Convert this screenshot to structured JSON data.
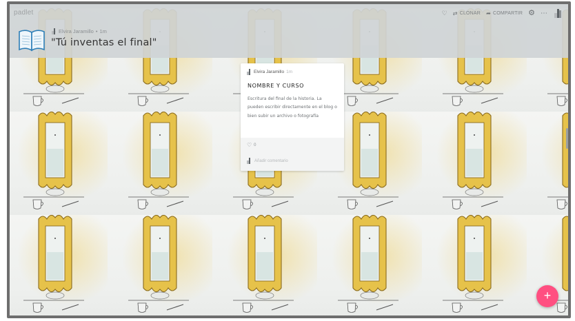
{
  "app": {
    "logo": "padlet"
  },
  "toolbar": {
    "heart_icon": "heart-outline-icon",
    "clone_label": "CLONAR",
    "share_label": "COMPARTIR",
    "settings_icon": "gear-icon",
    "more_icon": "ellipsis-icon"
  },
  "header": {
    "author": "Elvira Jaramillo",
    "separator": "•",
    "time": "1m",
    "title": "\"Tú inventas el final\""
  },
  "post": {
    "author": "Elvira Jaramillo",
    "time": "1m",
    "title": "NOMBRE Y CURSO",
    "body": "Escritura del final de la historia. La pueden escribir directamente en el blog o bien subir un archivo o fotografía",
    "likes": "0",
    "comment_placeholder": "Añadir comentario"
  },
  "fab": {
    "label": "+"
  },
  "colors": {
    "accent": "#ff4f81",
    "background": "#d6dadb"
  }
}
